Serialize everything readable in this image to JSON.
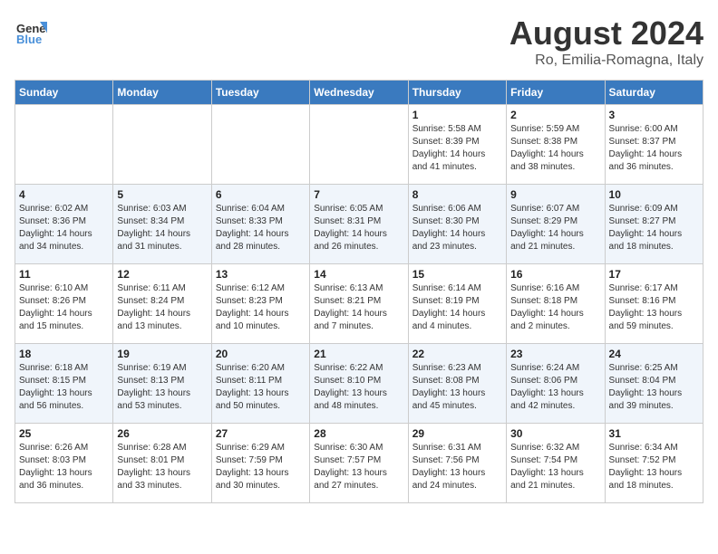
{
  "header": {
    "logo_line1": "General",
    "logo_line2": "Blue",
    "month_title": "August 2024",
    "location": "Ro, Emilia-Romagna, Italy"
  },
  "weekdays": [
    "Sunday",
    "Monday",
    "Tuesday",
    "Wednesday",
    "Thursday",
    "Friday",
    "Saturday"
  ],
  "weeks": [
    [
      {
        "day": "",
        "info": ""
      },
      {
        "day": "",
        "info": ""
      },
      {
        "day": "",
        "info": ""
      },
      {
        "day": "",
        "info": ""
      },
      {
        "day": "1",
        "info": "Sunrise: 5:58 AM\nSunset: 8:39 PM\nDaylight: 14 hours\nand 41 minutes."
      },
      {
        "day": "2",
        "info": "Sunrise: 5:59 AM\nSunset: 8:38 PM\nDaylight: 14 hours\nand 38 minutes."
      },
      {
        "day": "3",
        "info": "Sunrise: 6:00 AM\nSunset: 8:37 PM\nDaylight: 14 hours\nand 36 minutes."
      }
    ],
    [
      {
        "day": "4",
        "info": "Sunrise: 6:02 AM\nSunset: 8:36 PM\nDaylight: 14 hours\nand 34 minutes."
      },
      {
        "day": "5",
        "info": "Sunrise: 6:03 AM\nSunset: 8:34 PM\nDaylight: 14 hours\nand 31 minutes."
      },
      {
        "day": "6",
        "info": "Sunrise: 6:04 AM\nSunset: 8:33 PM\nDaylight: 14 hours\nand 28 minutes."
      },
      {
        "day": "7",
        "info": "Sunrise: 6:05 AM\nSunset: 8:31 PM\nDaylight: 14 hours\nand 26 minutes."
      },
      {
        "day": "8",
        "info": "Sunrise: 6:06 AM\nSunset: 8:30 PM\nDaylight: 14 hours\nand 23 minutes."
      },
      {
        "day": "9",
        "info": "Sunrise: 6:07 AM\nSunset: 8:29 PM\nDaylight: 14 hours\nand 21 minutes."
      },
      {
        "day": "10",
        "info": "Sunrise: 6:09 AM\nSunset: 8:27 PM\nDaylight: 14 hours\nand 18 minutes."
      }
    ],
    [
      {
        "day": "11",
        "info": "Sunrise: 6:10 AM\nSunset: 8:26 PM\nDaylight: 14 hours\nand 15 minutes."
      },
      {
        "day": "12",
        "info": "Sunrise: 6:11 AM\nSunset: 8:24 PM\nDaylight: 14 hours\nand 13 minutes."
      },
      {
        "day": "13",
        "info": "Sunrise: 6:12 AM\nSunset: 8:23 PM\nDaylight: 14 hours\nand 10 minutes."
      },
      {
        "day": "14",
        "info": "Sunrise: 6:13 AM\nSunset: 8:21 PM\nDaylight: 14 hours\nand 7 minutes."
      },
      {
        "day": "15",
        "info": "Sunrise: 6:14 AM\nSunset: 8:19 PM\nDaylight: 14 hours\nand 4 minutes."
      },
      {
        "day": "16",
        "info": "Sunrise: 6:16 AM\nSunset: 8:18 PM\nDaylight: 14 hours\nand 2 minutes."
      },
      {
        "day": "17",
        "info": "Sunrise: 6:17 AM\nSunset: 8:16 PM\nDaylight: 13 hours\nand 59 minutes."
      }
    ],
    [
      {
        "day": "18",
        "info": "Sunrise: 6:18 AM\nSunset: 8:15 PM\nDaylight: 13 hours\nand 56 minutes."
      },
      {
        "day": "19",
        "info": "Sunrise: 6:19 AM\nSunset: 8:13 PM\nDaylight: 13 hours\nand 53 minutes."
      },
      {
        "day": "20",
        "info": "Sunrise: 6:20 AM\nSunset: 8:11 PM\nDaylight: 13 hours\nand 50 minutes."
      },
      {
        "day": "21",
        "info": "Sunrise: 6:22 AM\nSunset: 8:10 PM\nDaylight: 13 hours\nand 48 minutes."
      },
      {
        "day": "22",
        "info": "Sunrise: 6:23 AM\nSunset: 8:08 PM\nDaylight: 13 hours\nand 45 minutes."
      },
      {
        "day": "23",
        "info": "Sunrise: 6:24 AM\nSunset: 8:06 PM\nDaylight: 13 hours\nand 42 minutes."
      },
      {
        "day": "24",
        "info": "Sunrise: 6:25 AM\nSunset: 8:04 PM\nDaylight: 13 hours\nand 39 minutes."
      }
    ],
    [
      {
        "day": "25",
        "info": "Sunrise: 6:26 AM\nSunset: 8:03 PM\nDaylight: 13 hours\nand 36 minutes."
      },
      {
        "day": "26",
        "info": "Sunrise: 6:28 AM\nSunset: 8:01 PM\nDaylight: 13 hours\nand 33 minutes."
      },
      {
        "day": "27",
        "info": "Sunrise: 6:29 AM\nSunset: 7:59 PM\nDaylight: 13 hours\nand 30 minutes."
      },
      {
        "day": "28",
        "info": "Sunrise: 6:30 AM\nSunset: 7:57 PM\nDaylight: 13 hours\nand 27 minutes."
      },
      {
        "day": "29",
        "info": "Sunrise: 6:31 AM\nSunset: 7:56 PM\nDaylight: 13 hours\nand 24 minutes."
      },
      {
        "day": "30",
        "info": "Sunrise: 6:32 AM\nSunset: 7:54 PM\nDaylight: 13 hours\nand 21 minutes."
      },
      {
        "day": "31",
        "info": "Sunrise: 6:34 AM\nSunset: 7:52 PM\nDaylight: 13 hours\nand 18 minutes."
      }
    ]
  ]
}
